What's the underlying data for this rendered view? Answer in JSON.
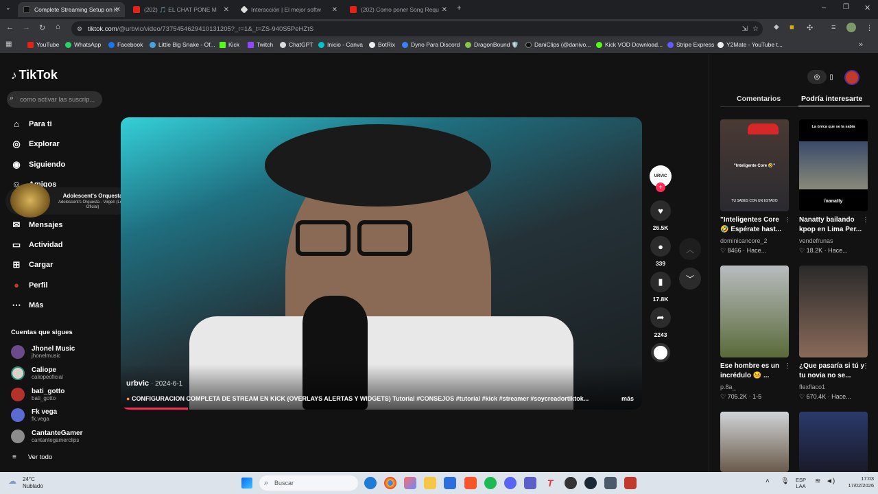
{
  "browser": {
    "tabs": [
      {
        "title": "Complete Streaming Setup on K",
        "active": true
      },
      {
        "title": "(202) 🎵 EL CHAT PONE M"
      },
      {
        "title": "Interacción | El mejor softw"
      },
      {
        "title": "(202) Como poner Song Requ"
      }
    ],
    "url_main": "tiktok.com",
    "url_rest": "/@urbvic/video/7375454629410131205?_r=1&_t=ZS-940S5PeHZtS",
    "bookmarks": [
      "YouTube",
      "WhatsApp",
      "Facebook",
      "Little Big Snake - Of...",
      "Kick",
      "Twitch",
      "ChatGPT",
      "Inicio - Canva",
      "BotRix",
      "Dyno Para Discord",
      "DragonBound 🛡️",
      "DaniClips (@danivo...",
      "Kick VOD Download...",
      "Stripe Express",
      "Y2Mate - YouTube t..."
    ]
  },
  "tiktok": {
    "logo": "TikTok",
    "search_placeholder": "como activar las suscrip...",
    "nav": [
      "Para ti",
      "Explorar",
      "Siguiendo",
      "Amigos",
      "Mensajes",
      "Actividad",
      "Cargar",
      "Perfil",
      "Más"
    ],
    "following_title": "Cuentas que sigues",
    "following": [
      {
        "name": "Jhonel Music",
        "handle": "jhonelmusic"
      },
      {
        "name": "Caliope",
        "handle": "caliopeoficial"
      },
      {
        "name": "bati_gotto",
        "handle": "bati_gotto"
      },
      {
        "name": "Fk vega",
        "handle": "fk.vega"
      },
      {
        "name": "CantanteGamer",
        "handle": "cantantegamerclips"
      }
    ],
    "see_all": "Ver todo",
    "media_popup": {
      "title": "Adolescent's Orquesta",
      "subtitle": "Adolescent's Orquesta - Virgen (Letra Oficial)"
    },
    "video": {
      "author": "urbvic",
      "date": "· 2024-6-1",
      "caption": "CONFIGURACION COMPLETA DE STREAM EN KICK (OVERLAYS ALERTAS Y WIDGETS) Tutorial #CONSEJOS #tutorial #kick #streamer #soycreadortiktok...",
      "more": "más",
      "avatar_text": "URVIC",
      "likes": "26.5K",
      "comments": "339",
      "saves": "17.8K",
      "shares": "2243"
    },
    "right_tabs": [
      "Comentarios",
      "Podría interesarte"
    ],
    "cards": [
      {
        "title": "\"Inteligentes Core 🤣 Espérate hast...",
        "user": "dominicancore_2",
        "likes": "8466",
        "time": "Hace...",
        "overlay_top": "\"Inteligente Core 🤣\"",
        "overlay_bottom": "TU SABES CON UN ESTADO"
      },
      {
        "title": "Nanatty bailando kpop en Lima Per...",
        "user": "vendefrunas",
        "likes": "18.2K",
        "time": "Hace...",
        "overlay_top": "La única que se la sabía",
        "overlay_bottom": "/nanatty"
      },
      {
        "title": "Ese hombre es un incrédulo 🤒 ...",
        "user": "p.8a_",
        "likes": "705.2K",
        "time": "1-5"
      },
      {
        "title": "¿Que pasaría si tú y tu novia no se...",
        "user": "flexflaco1",
        "likes": "670.4K",
        "time": "Hace..."
      },
      {
        "title": "",
        "user": "",
        "likes": "",
        "time": ""
      },
      {
        "title": "",
        "user": "",
        "likes": "",
        "time": ""
      }
    ]
  },
  "taskbar": {
    "weather_temp": "24°C",
    "weather_desc": "Nublado",
    "search": "Buscar",
    "lang1": "ESP",
    "lang2": "LAA",
    "time": "17:03",
    "date": "17/02/2026"
  }
}
